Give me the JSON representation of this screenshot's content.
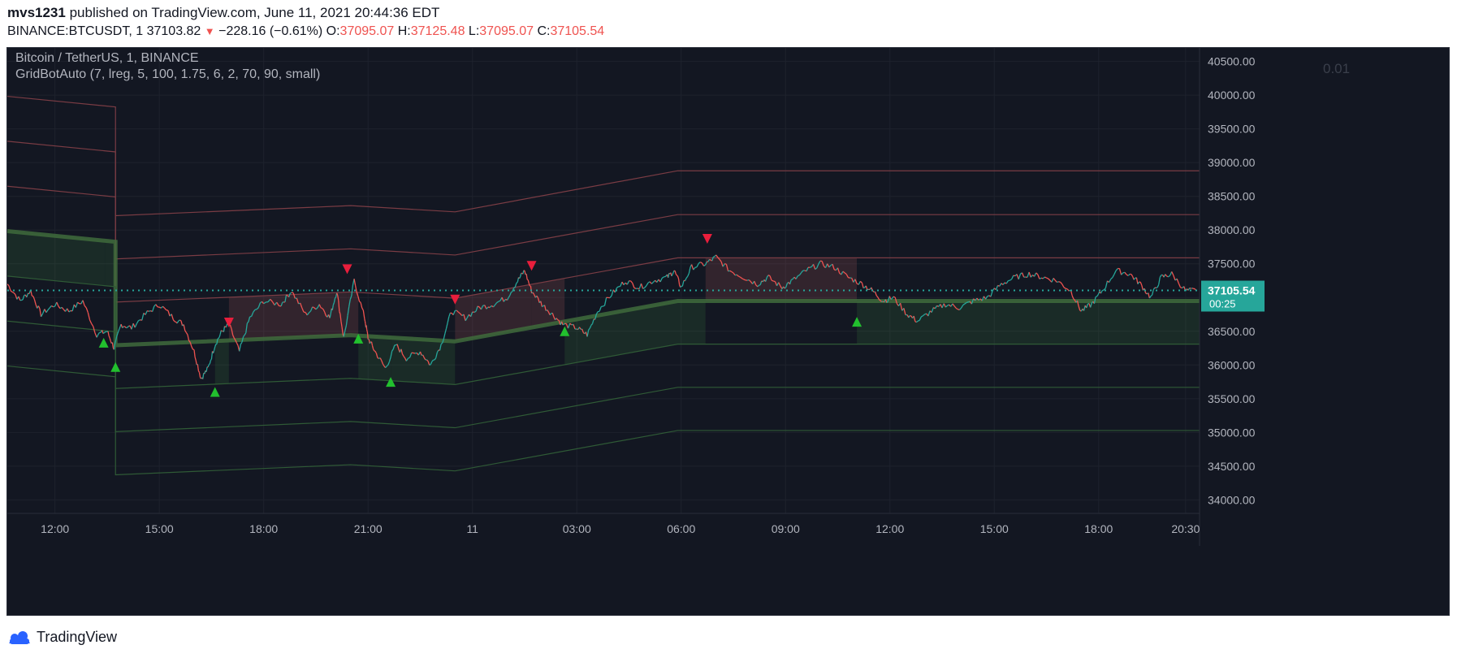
{
  "header": {
    "author": "mvs1231",
    "published_text": "published on TradingView.com, June 11, 2021 20:44:36 EDT",
    "symbol": "BINANCE:BTCUSDT, 1",
    "last": "37103.82",
    "change": "−228.16 (−0.61%)",
    "o_label": "O:",
    "o": "37095.07",
    "h_label": "H:",
    "h": "37125.48",
    "l_label": "L:",
    "l": "37095.07",
    "c_label": "C:",
    "c": "37105.54"
  },
  "legend": {
    "series": "Bitcoin / TetherUS, 1, BINANCE",
    "indicator": "GridBotAuto (7, lreg, 5, 100, 1.75, 6, 2, 70, 90, small)",
    "scale": "0.01"
  },
  "price_badge": {
    "price": "37105.54",
    "countdown": "00:25"
  },
  "footer": {
    "brand": "TradingView"
  },
  "colors": {
    "background": "#131722",
    "up": "#26a69a",
    "down": "#ef5350",
    "grid_green": "#4caf50",
    "grid_red": "#e57373",
    "buy_marker": "#22c02e",
    "sell_marker": "#e91e3c",
    "badge": "#26a69a"
  },
  "chart_data": {
    "type": "line",
    "title": "Bitcoin / TetherUS, 1, BINANCE",
    "ylim": [
      33800,
      40700
    ],
    "y_ticks": [
      34000,
      34500,
      35000,
      35500,
      36000,
      36500,
      37000,
      37500,
      38000,
      38500,
      39000,
      39500,
      40000,
      40500
    ],
    "y_tick_labels": [
      "34000.00",
      "34500.00",
      "35000.00",
      "35500.00",
      "36000.00",
      "36500.00",
      "37000.00",
      "37500.00",
      "38000.00",
      "38500.00",
      "39000.00",
      "39500.00",
      "40000.00",
      "40500.00"
    ],
    "x_ticks": [
      {
        "label": "12:00",
        "t": 12.0
      },
      {
        "label": "15:00",
        "t": 15.0
      },
      {
        "label": "18:00",
        "t": 18.0
      },
      {
        "label": "21:00",
        "t": 21.0
      },
      {
        "label": "11",
        "t": 24.0
      },
      {
        "label": "03:00",
        "t": 27.0
      },
      {
        "label": "06:00",
        "t": 30.0
      },
      {
        "label": "09:00",
        "t": 33.0
      },
      {
        "label": "12:00",
        "t": 36.0
      },
      {
        "label": "15:00",
        "t": 39.0
      },
      {
        "label": "18:00",
        "t": 42.0
      },
      {
        "label": "20:30",
        "t": 44.5
      }
    ],
    "xlim": [
      10.63,
      44.9
    ],
    "current_price": 37105.54,
    "price_path": [
      [
        10.63,
        37200
      ],
      [
        11.0,
        36950
      ],
      [
        11.3,
        37100
      ],
      [
        11.6,
        36750
      ],
      [
        12.0,
        36900
      ],
      [
        12.4,
        36800
      ],
      [
        12.8,
        36950
      ],
      [
        13.2,
        36450
      ],
      [
        13.5,
        36500
      ],
      [
        13.7,
        36250
      ],
      [
        13.9,
        36600
      ],
      [
        14.2,
        36550
      ],
      [
        14.6,
        36750
      ],
      [
        15.0,
        36900
      ],
      [
        15.4,
        36700
      ],
      [
        15.7,
        36600
      ],
      [
        16.0,
        36200
      ],
      [
        16.2,
        35800
      ],
      [
        16.4,
        35950
      ],
      [
        16.6,
        36300
      ],
      [
        16.8,
        36500
      ],
      [
        17.0,
        36600
      ],
      [
        17.3,
        36200
      ],
      [
        17.6,
        36700
      ],
      [
        18.0,
        36950
      ],
      [
        18.5,
        36900
      ],
      [
        18.8,
        37100
      ],
      [
        19.2,
        36750
      ],
      [
        19.6,
        36900
      ],
      [
        19.9,
        36700
      ],
      [
        20.1,
        37100
      ],
      [
        20.3,
        36400
      ],
      [
        20.6,
        37250
      ],
      [
        20.9,
        36700
      ],
      [
        21.0,
        36400
      ],
      [
        21.2,
        36200
      ],
      [
        21.5,
        35950
      ],
      [
        21.8,
        36300
      ],
      [
        22.1,
        36100
      ],
      [
        22.5,
        36200
      ],
      [
        22.8,
        36000
      ],
      [
        23.1,
        36300
      ],
      [
        23.4,
        36800
      ],
      [
        23.8,
        36700
      ],
      [
        24.2,
        36850
      ],
      [
        24.6,
        36900
      ],
      [
        25.0,
        37000
      ],
      [
        25.3,
        37250
      ],
      [
        25.5,
        37400
      ],
      [
        25.7,
        37100
      ],
      [
        26.0,
        36900
      ],
      [
        26.3,
        36750
      ],
      [
        26.6,
        36600
      ],
      [
        27.0,
        36550
      ],
      [
        27.3,
        36450
      ],
      [
        27.6,
        36800
      ],
      [
        28.0,
        37050
      ],
      [
        28.4,
        37250
      ],
      [
        28.8,
        37150
      ],
      [
        29.2,
        37250
      ],
      [
        29.6,
        37300
      ],
      [
        29.8,
        37400
      ],
      [
        30.0,
        37150
      ],
      [
        30.3,
        37450
      ],
      [
        30.7,
        37500
      ],
      [
        31.0,
        37600
      ],
      [
        31.4,
        37400
      ],
      [
        31.8,
        37300
      ],
      [
        32.2,
        37200
      ],
      [
        32.5,
        37300
      ],
      [
        32.9,
        37150
      ],
      [
        33.2,
        37250
      ],
      [
        33.6,
        37400
      ],
      [
        34.0,
        37500
      ],
      [
        34.4,
        37450
      ],
      [
        34.8,
        37300
      ],
      [
        35.2,
        37200
      ],
      [
        35.5,
        37100
      ],
      [
        35.8,
        36950
      ],
      [
        36.1,
        37000
      ],
      [
        36.5,
        36750
      ],
      [
        36.8,
        36650
      ],
      [
        37.2,
        36800
      ],
      [
        37.6,
        36900
      ],
      [
        38.0,
        36850
      ],
      [
        38.4,
        36950
      ],
      [
        38.8,
        37000
      ],
      [
        39.2,
        37200
      ],
      [
        39.6,
        37300
      ],
      [
        40.0,
        37350
      ],
      [
        40.4,
        37300
      ],
      [
        40.8,
        37250
      ],
      [
        41.2,
        37100
      ],
      [
        41.5,
        36800
      ],
      [
        41.8,
        36900
      ],
      [
        42.1,
        37100
      ],
      [
        42.5,
        37400
      ],
      [
        42.9,
        37350
      ],
      [
        43.2,
        37200
      ],
      [
        43.5,
        37000
      ],
      [
        43.8,
        37300
      ],
      [
        44.1,
        37350
      ],
      [
        44.5,
        37100
      ],
      [
        44.8,
        37105.54
      ]
    ],
    "grid_lines": {
      "red": [
        [
          [
            10.63,
            39983
          ],
          [
            13.74,
            39825
          ],
          [
            13.74,
            38213
          ],
          [
            20.5,
            38362
          ],
          [
            23.5,
            38270
          ],
          [
            29.9,
            38879
          ],
          [
            44.9,
            38879
          ]
        ],
        [
          [
            10.63,
            39317
          ],
          [
            13.74,
            39159
          ],
          [
            13.74,
            37572
          ],
          [
            20.5,
            37722
          ],
          [
            23.5,
            37630
          ],
          [
            29.9,
            38229
          ],
          [
            44.9,
            38229
          ]
        ],
        [
          [
            10.63,
            38650
          ],
          [
            13.74,
            38492
          ],
          [
            13.74,
            36932
          ],
          [
            20.5,
            37082
          ],
          [
            23.5,
            36990
          ],
          [
            29.9,
            37589
          ],
          [
            44.9,
            37589
          ]
        ]
      ],
      "mid": [
        [
          10.63,
          37985
        ],
        [
          13.74,
          37826
        ],
        [
          13.74,
          36292
        ],
        [
          20.5,
          36442
        ],
        [
          23.5,
          36350
        ],
        [
          29.9,
          36949
        ],
        [
          44.9,
          36949
        ]
      ],
      "green": [
        [
          [
            10.63,
            37318
          ],
          [
            13.74,
            37160
          ],
          [
            13.74,
            35652
          ],
          [
            20.5,
            35802
          ],
          [
            23.5,
            35710
          ],
          [
            29.9,
            36309
          ],
          [
            44.9,
            36309
          ]
        ],
        [
          [
            10.63,
            36651
          ],
          [
            13.74,
            36493
          ],
          [
            13.74,
            35012
          ],
          [
            20.5,
            35162
          ],
          [
            23.5,
            35070
          ],
          [
            29.9,
            35669
          ],
          [
            44.9,
            35669
          ]
        ],
        [
          [
            10.63,
            35985
          ],
          [
            13.74,
            35826
          ],
          [
            13.74,
            34372
          ],
          [
            20.5,
            34522
          ],
          [
            23.5,
            34430
          ],
          [
            29.9,
            35029
          ],
          [
            44.9,
            35029
          ]
        ]
      ]
    },
    "zones": [
      {
        "kind": "buy",
        "t0": 10.63,
        "t1": 13.44
      },
      {
        "kind": "buy",
        "t0": 13.44,
        "t1": 13.74
      },
      {
        "kind": "buy",
        "t0": 16.6,
        "t1": 17.0
      },
      {
        "kind": "sell",
        "t0": 17.0,
        "t1": 20.4
      },
      {
        "kind": "sell",
        "t0": 20.4,
        "t1": 20.72
      },
      {
        "kind": "buy",
        "t0": 20.72,
        "t1": 21.65
      },
      {
        "kind": "buy",
        "t0": 21.65,
        "t1": 23.5
      },
      {
        "kind": "sell",
        "t0": 23.5,
        "t1": 25.7
      },
      {
        "kind": "sell",
        "t0": 25.7,
        "t1": 26.65
      },
      {
        "kind": "buy",
        "t0": 26.65,
        "t1": 30.7
      },
      {
        "kind": "sell",
        "t0": 30.7,
        "t1": 35.05
      },
      {
        "kind": "buy",
        "t0": 35.05,
        "t1": 44.9
      }
    ],
    "markers": [
      {
        "kind": "buy",
        "t": 13.4,
        "price": 36330
      },
      {
        "kind": "buy",
        "t": 13.74,
        "price": 35970
      },
      {
        "kind": "buy",
        "t": 16.6,
        "price": 35600
      },
      {
        "kind": "sell",
        "t": 17.0,
        "price": 36630
      },
      {
        "kind": "sell",
        "t": 20.4,
        "price": 37420
      },
      {
        "kind": "buy",
        "t": 20.72,
        "price": 36390
      },
      {
        "kind": "buy",
        "t": 21.65,
        "price": 35750
      },
      {
        "kind": "sell",
        "t": 23.5,
        "price": 36970
      },
      {
        "kind": "sell",
        "t": 25.7,
        "price": 37470
      },
      {
        "kind": "buy",
        "t": 26.65,
        "price": 36500
      },
      {
        "kind": "sell",
        "t": 30.75,
        "price": 37870
      },
      {
        "kind": "buy",
        "t": 35.05,
        "price": 36640
      }
    ]
  }
}
